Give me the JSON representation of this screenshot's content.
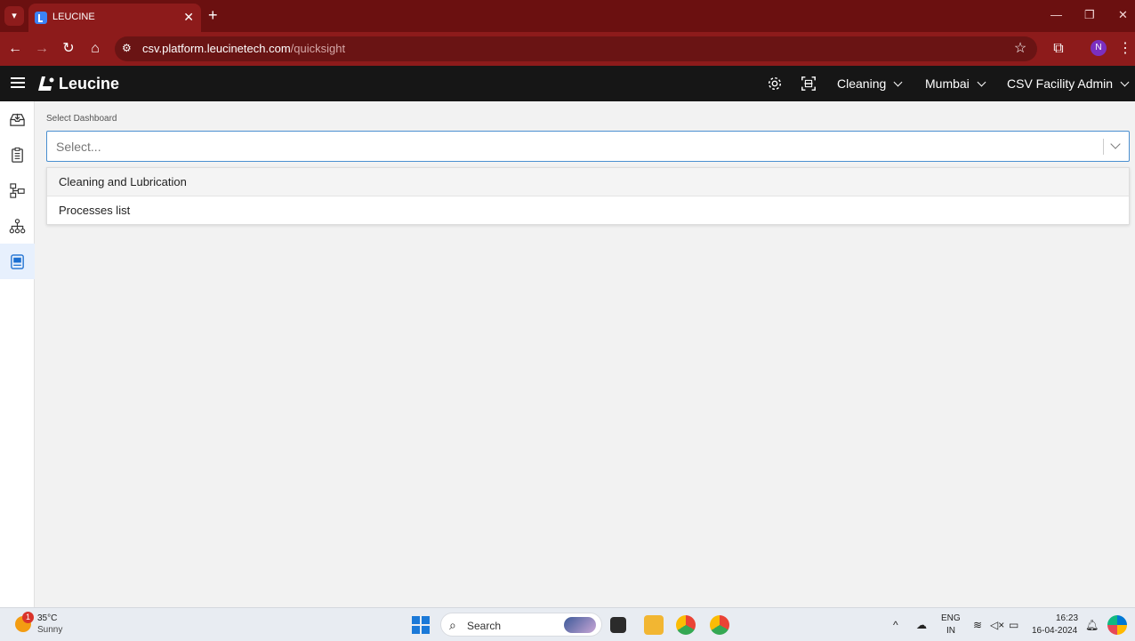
{
  "browser": {
    "tab_title": "LEUCINE",
    "url_host": "csv.platform.leucinetech.com",
    "url_path": "/quicksight",
    "profile_initial": "N"
  },
  "app": {
    "brand": "Leucine",
    "header": {
      "use_case": "Cleaning",
      "facility": "Mumbai",
      "role": "CSV Facility Admin"
    },
    "sidebar": [
      {
        "icon": "inbox-icon"
      },
      {
        "icon": "checklist-icon"
      },
      {
        "icon": "process-flow-icon"
      },
      {
        "icon": "hierarchy-icon"
      },
      {
        "icon": "dashboard-icon",
        "active": true
      }
    ]
  },
  "main": {
    "select_label": "Select Dashboard",
    "select_placeholder": "Select...",
    "options": [
      "Cleaning and Lubrication",
      "Processes list"
    ]
  },
  "taskbar": {
    "weather_temp": "35°C",
    "weather_condition": "Sunny",
    "weather_badge": "1",
    "search_text": "Search",
    "lang_top": "ENG",
    "lang_bottom": "IN",
    "time": "16:23",
    "date": "16-04-2024"
  },
  "colors": {
    "browser_frame": "#6b1010",
    "browser_toolbar": "#8d1b1b",
    "app_header": "#161616",
    "select_border": "#4a8fd0",
    "sidebar_active": "#e7f0fd"
  }
}
